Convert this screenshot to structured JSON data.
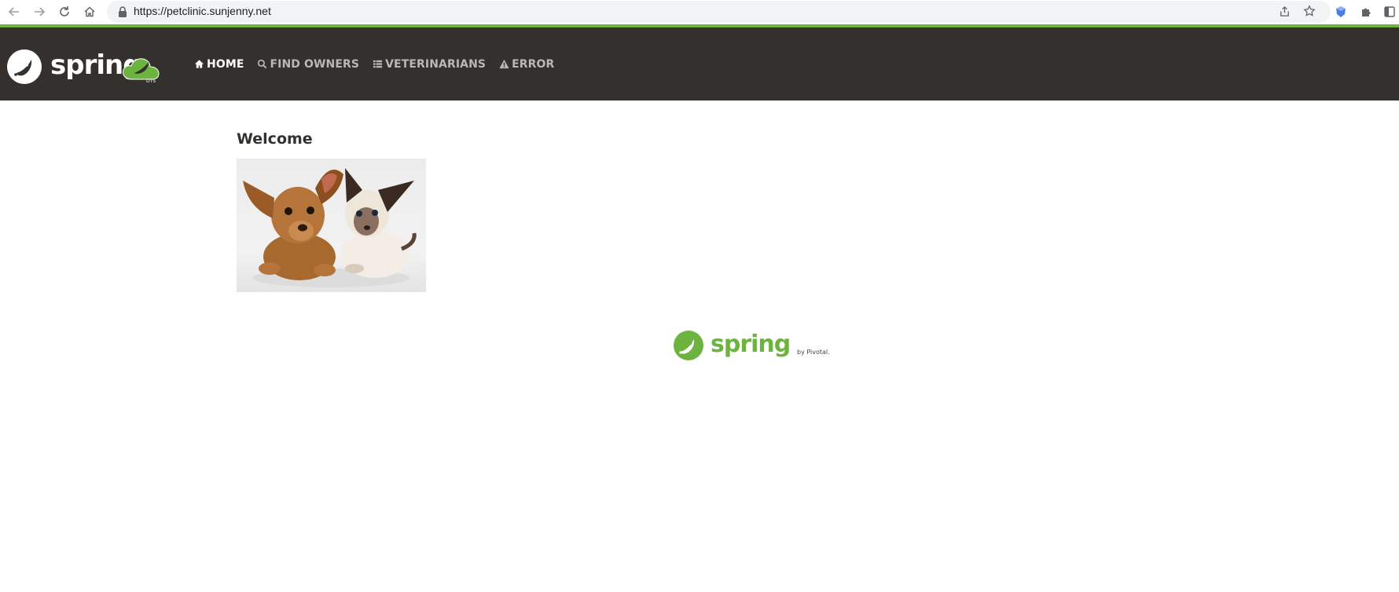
{
  "browser": {
    "url": "https://petclinic.sunjenny.net",
    "icons": [
      "back-icon",
      "forward-icon",
      "reload-icon",
      "home-icon",
      "lock-icon",
      "share-icon",
      "star-icon",
      "extension-shield-icon",
      "puzzle-icon",
      "sidebar-icon"
    ]
  },
  "navbar": {
    "brand": "spring",
    "items": [
      {
        "label": "HOME",
        "icon": "home-icon",
        "active": true
      },
      {
        "label": "FIND OWNERS",
        "icon": "search-icon",
        "active": false
      },
      {
        "label": "VETERINARIANS",
        "icon": "list-icon",
        "active": false
      },
      {
        "label": "ERROR",
        "icon": "warning-icon",
        "active": false
      }
    ]
  },
  "main": {
    "title": "Welcome",
    "image_description_icon": "pets-image"
  },
  "footer": {
    "brand": "spring",
    "by": "by Pivotal."
  },
  "colors": {
    "spring_green": "#6db33f",
    "navbar_bg": "#34302d",
    "nav_active": "#ffffff",
    "nav_inactive": "#b8b8b8"
  }
}
